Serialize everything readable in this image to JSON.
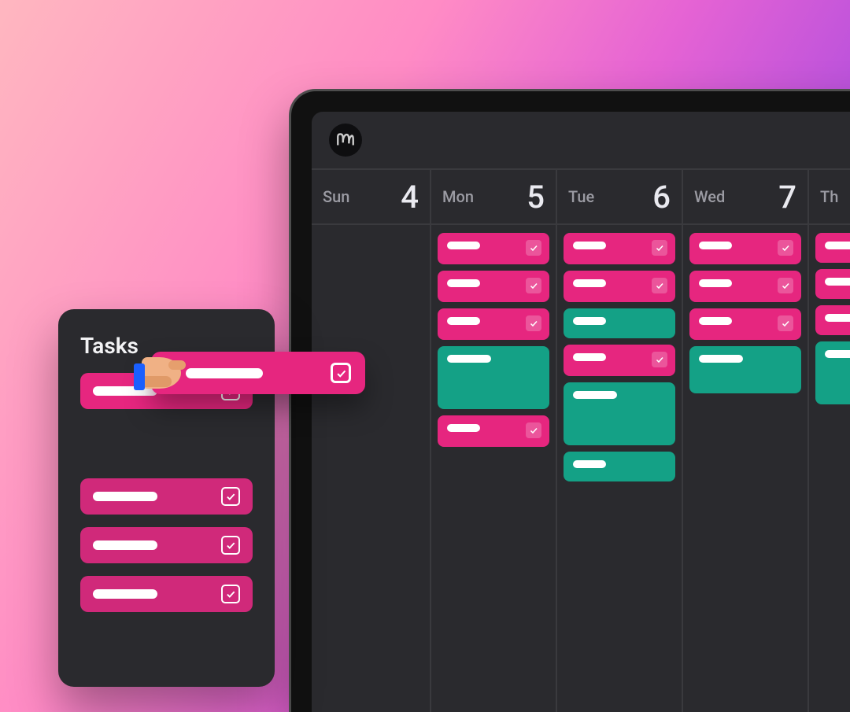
{
  "tasks_panel": {
    "title": "Tasks",
    "groups": [
      {
        "items": [
          {
            "checked": true
          }
        ]
      },
      {
        "items": [
          {
            "checked": true
          },
          {
            "checked": true
          },
          {
            "checked": true
          }
        ]
      }
    ],
    "dragging": {
      "checked": true
    }
  },
  "calendar": {
    "days": [
      {
        "dow": "Sun",
        "num": "4",
        "cards": []
      },
      {
        "dow": "Mon",
        "num": "5",
        "cards": [
          {
            "color": "pink",
            "size": "s",
            "checked": true
          },
          {
            "color": "pink",
            "size": "s",
            "checked": true
          },
          {
            "color": "pink",
            "size": "s",
            "checked": true
          },
          {
            "color": "teal",
            "size": "tall",
            "checked": false
          },
          {
            "color": "pink",
            "size": "s",
            "checked": true
          }
        ]
      },
      {
        "dow": "Tue",
        "num": "6",
        "cards": [
          {
            "color": "pink",
            "size": "s",
            "checked": true
          },
          {
            "color": "pink",
            "size": "s",
            "checked": true
          },
          {
            "color": "teal",
            "size": "s",
            "checked": false
          },
          {
            "color": "pink",
            "size": "s",
            "checked": true
          },
          {
            "color": "teal",
            "size": "tall",
            "checked": false
          },
          {
            "color": "teal",
            "size": "s",
            "checked": false
          }
        ]
      },
      {
        "dow": "Wed",
        "num": "7",
        "cards": [
          {
            "color": "pink",
            "size": "s",
            "checked": true
          },
          {
            "color": "pink",
            "size": "s",
            "checked": true
          },
          {
            "color": "pink",
            "size": "s",
            "checked": true
          },
          {
            "color": "teal",
            "size": "med",
            "checked": false
          }
        ]
      },
      {
        "dow": "Th",
        "num": "",
        "cards": [
          {
            "color": "pink",
            "size": "s",
            "checked": false
          },
          {
            "color": "pink",
            "size": "s",
            "checked": false
          },
          {
            "color": "pink",
            "size": "s",
            "checked": false
          },
          {
            "color": "teal",
            "size": "tall",
            "checked": false
          }
        ]
      }
    ]
  }
}
